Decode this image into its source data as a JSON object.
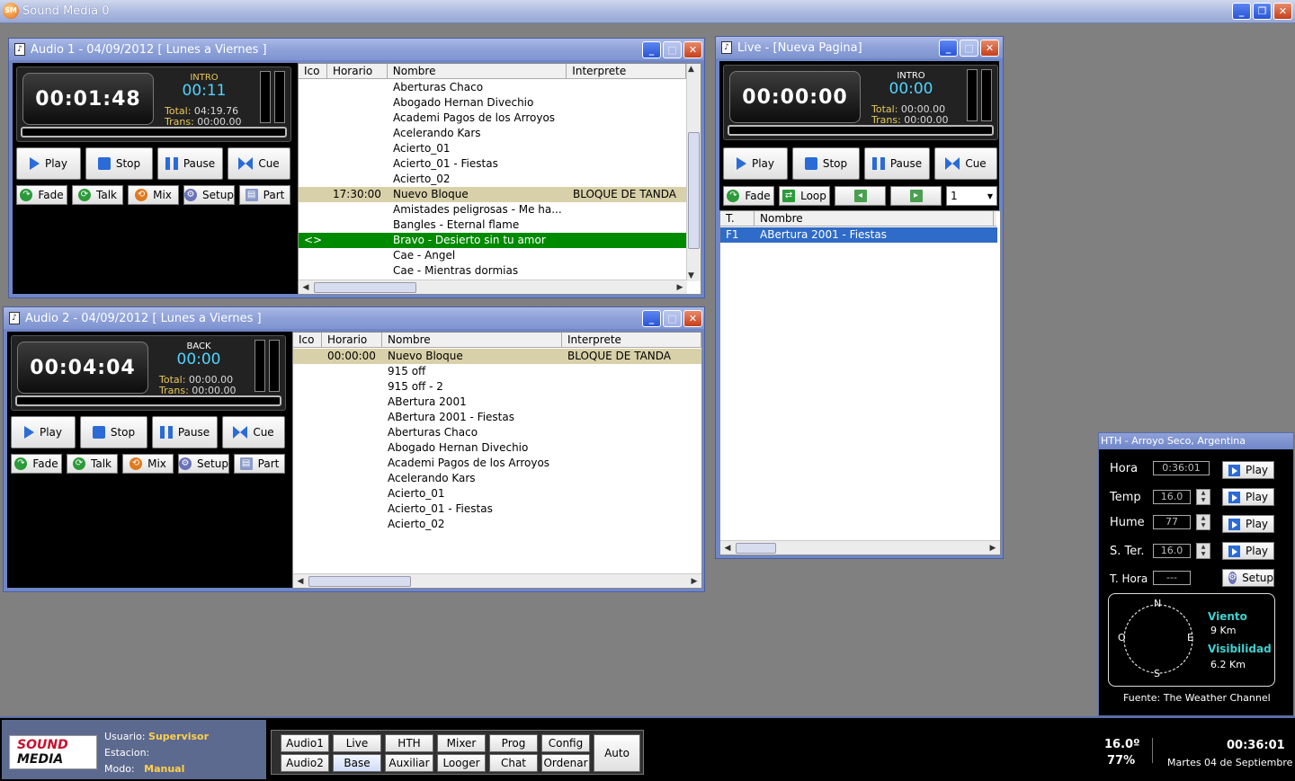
{
  "app": {
    "title": "Sound Media 0",
    "logo": "SM"
  },
  "audio1": {
    "title": "Audio 1 - 04/09/2012 [ Lunes a Viernes ]",
    "time": "00:01:48",
    "mode": "INTRO",
    "intro": "00:11",
    "total_label": "Total:",
    "total": "04:19.76",
    "trans_label": "Trans:",
    "trans": "00:00.00",
    "buttons": [
      "Play",
      "Stop",
      "Pause",
      "Cue"
    ],
    "small": [
      "Fade",
      "Talk",
      "Mix",
      "Setup",
      "Part"
    ],
    "columns": [
      "Ico",
      "Horario",
      "Nombre",
      "Interprete"
    ],
    "rows": [
      {
        "ico": "",
        "hora": "",
        "nombre": "Aberturas  Chaco",
        "interp": ""
      },
      {
        "ico": "",
        "hora": "",
        "nombre": "Abogado Hernan Divechio",
        "interp": ""
      },
      {
        "ico": "",
        "hora": "",
        "nombre": "Academi Pagos de los Arroyos",
        "interp": ""
      },
      {
        "ico": "",
        "hora": "",
        "nombre": "Acelerando Kars",
        "interp": ""
      },
      {
        "ico": "",
        "hora": "",
        "nombre": "Acierto_01",
        "interp": ""
      },
      {
        "ico": "",
        "hora": "",
        "nombre": "Acierto_01 - Fiestas",
        "interp": ""
      },
      {
        "ico": "",
        "hora": "",
        "nombre": "Acierto_02",
        "interp": ""
      },
      {
        "ico": "",
        "hora": "17:30:00",
        "nombre": "Nuevo Bloque",
        "interp": "BLOQUE DE TANDA"
      },
      {
        "ico": "",
        "hora": "",
        "nombre": "Amistades peligrosas - Me ha...",
        "interp": ""
      },
      {
        "ico": "",
        "hora": "",
        "nombre": "Bangles - Eternal flame",
        "interp": ""
      },
      {
        "ico": "<>",
        "hora": "",
        "nombre": "Bravo - Desierto sin tu amor",
        "interp": ""
      },
      {
        "ico": "",
        "hora": "",
        "nombre": "Cae - Angel",
        "interp": ""
      },
      {
        "ico": "",
        "hora": "",
        "nombre": "Cae - Mientras dormias",
        "interp": ""
      }
    ]
  },
  "audio2": {
    "title": "Audio 2 - 04/09/2012 [ Lunes a Viernes ]",
    "time": "00:04:04",
    "mode": "BACK",
    "intro": "00:00",
    "total_label": "Total:",
    "total": "00:00.00",
    "trans_label": "Trans:",
    "trans": "00:00.00",
    "buttons": [
      "Play",
      "Stop",
      "Pause",
      "Cue"
    ],
    "small": [
      "Fade",
      "Talk",
      "Mix",
      "Setup",
      "Part"
    ],
    "columns": [
      "Ico",
      "Horario",
      "Nombre",
      "Interprete"
    ],
    "rows": [
      {
        "ico": "",
        "hora": "00:00:00",
        "nombre": "Nuevo Bloque",
        "interp": "BLOQUE DE TANDA"
      },
      {
        "ico": "",
        "hora": "",
        "nombre": "915 off",
        "interp": ""
      },
      {
        "ico": "",
        "hora": "",
        "nombre": "915 off - 2",
        "interp": ""
      },
      {
        "ico": "",
        "hora": "",
        "nombre": "ABertura 2001",
        "interp": ""
      },
      {
        "ico": "",
        "hora": "",
        "nombre": "ABertura 2001 - Fiestas",
        "interp": ""
      },
      {
        "ico": "",
        "hora": "",
        "nombre": "Aberturas  Chaco",
        "interp": ""
      },
      {
        "ico": "",
        "hora": "",
        "nombre": "Abogado Hernan Divechio",
        "interp": ""
      },
      {
        "ico": "",
        "hora": "",
        "nombre": "Academi Pagos de los Arroyos",
        "interp": ""
      },
      {
        "ico": "",
        "hora": "",
        "nombre": "Acelerando Kars",
        "interp": ""
      },
      {
        "ico": "",
        "hora": "",
        "nombre": "Acierto_01",
        "interp": ""
      },
      {
        "ico": "",
        "hora": "",
        "nombre": "Acierto_01 - Fiestas",
        "interp": ""
      },
      {
        "ico": "",
        "hora": "",
        "nombre": "Acierto_02",
        "interp": ""
      }
    ]
  },
  "live": {
    "title": "Live - [Nueva Pagina]",
    "time": "00:00:00",
    "mode": "INTRO",
    "intro": "00:00",
    "total_label": "Total:",
    "total": "00:00.00",
    "trans_label": "Trans:",
    "trans": "00:00.00",
    "buttons": [
      "Play",
      "Stop",
      "Pause",
      "Cue"
    ],
    "fade": "Fade",
    "loop": "Loop",
    "page": "1",
    "columns": [
      "T.",
      "Nombre"
    ],
    "rows": [
      {
        "t": "F1",
        "nombre": "ABertura 2001 - Fiestas"
      }
    ]
  },
  "hth": {
    "title": "HTH - Arroyo Seco, Argentina",
    "rows": [
      {
        "label": "Hora",
        "value": "0:36:01",
        "btn": "Play"
      },
      {
        "label": "Temp",
        "value": "16.0",
        "btn": "Play"
      },
      {
        "label": "Hume",
        "value": "77",
        "btn": "Play"
      },
      {
        "label": "S. Ter.",
        "value": "16.0",
        "btn": "Play"
      },
      {
        "label": "T. Hora",
        "value": "---",
        "btn": "Setup"
      }
    ],
    "compass": {
      "n": "N",
      "s": "S",
      "e": "E",
      "o": "O"
    },
    "viento_label": "Viento",
    "viento": "9 Km",
    "visibilidad_label": "Visibilidad",
    "visibilidad": "6.2 Km",
    "fuente": "Fuente: The Weather Channel"
  },
  "status": {
    "logo_top": "SOUND",
    "logo_bottom": "MEDIA",
    "usuario_label": "Usuario:",
    "usuario": "Supervisor",
    "estacion_label": "Estacion:",
    "estacion": "",
    "modo_label": "Modo:",
    "modo": "Manual",
    "nav_top": [
      "Audio1",
      "Live",
      "HTH",
      "Mixer",
      "Prog",
      "Config"
    ],
    "nav_bottom": [
      "Audio2",
      "Base",
      "Auxiliar",
      "Looger",
      "Chat",
      "Ordenar"
    ],
    "auto": "Auto",
    "temp": "16.0º",
    "hum": "77%",
    "time": "00:36:01",
    "date": "Martes 04 de Septiembre"
  },
  "colors": {
    "highlight_tan": "#d8d0a8",
    "highlight_green": "#008a00",
    "highlight_blue": "#2f6bc8",
    "accent_cyan": "#4fd4ff"
  }
}
